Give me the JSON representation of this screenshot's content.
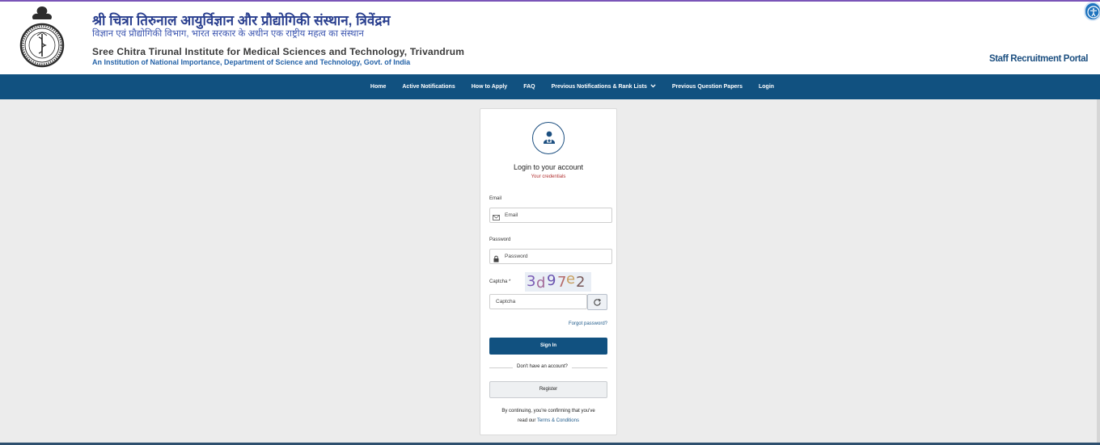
{
  "header": {
    "hindi_title": "श्री चित्रा तिरुनाल आयुर्विज्ञान और प्रौद्योगिकी संस्थान, त्रिवेंद्रम",
    "hindi_subtitle": "विज्ञान एवं प्रौद्योगिकी विभाग, भारत सरकार के अधीन एक राष्ट्रीय महत्व का संस्थान",
    "english_title": "Sree Chitra Tirunal Institute for Medical Sciences and Technology, Trivandrum",
    "english_subtitle": "An Institution of National Importance, Department of Science and Technology, Govt. of India",
    "portal_name": "Staff Recruitment Portal"
  },
  "nav": {
    "items": [
      {
        "label": "Home"
      },
      {
        "label": "Active Notifications"
      },
      {
        "label": "How to Apply"
      },
      {
        "label": "FAQ"
      },
      {
        "label": "Previous Notifications & Rank Lists"
      },
      {
        "label": "Previous Question Papers"
      },
      {
        "label": "Login"
      }
    ]
  },
  "login": {
    "title": "Login to your account",
    "subtitle": "Your credentials",
    "email_label": "Email",
    "email_placeholder": "Email",
    "password_label": "Password",
    "password_placeholder": "Password",
    "captcha_label": "Captcha *",
    "captcha_text": [
      "3",
      "d",
      "9",
      "7",
      "e",
      "2"
    ],
    "captcha_placeholder": "Captcha",
    "forgot": "Forgot password?",
    "signin": "Sign In",
    "divider": "Don't have an account?",
    "register": "Register",
    "terms_line1": "By continuing, you're confirming that you've",
    "terms_line2_prefix": "read our",
    "terms_link": "Terms & Conditions"
  },
  "colors": {
    "nav_bg": "#115180",
    "accent": "#115180",
    "error_text": "#b23030",
    "link": "#1f5a8a"
  }
}
